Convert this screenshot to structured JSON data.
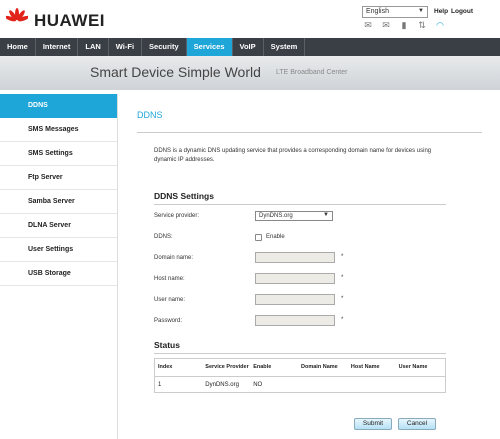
{
  "header": {
    "brand": "HUAWEI",
    "language": "English",
    "help_label": "Help",
    "logout_label": "Logout"
  },
  "nav": {
    "items": [
      "Home",
      "Internet",
      "LAN",
      "Wi-Fi",
      "Security",
      "Services",
      "VoIP",
      "System"
    ],
    "active": "Services"
  },
  "banner": {
    "slogan": "Smart Device  Simple World",
    "subtitle": "LTE Broadband Center"
  },
  "sidebar": {
    "items": [
      "DDNS",
      "SMS Messages",
      "SMS Settings",
      "Ftp Server",
      "Samba Server",
      "DLNA Server",
      "User Settings",
      "USB Storage"
    ],
    "active": "DDNS"
  },
  "main": {
    "title": "DDNS",
    "description": "DDNS is a dynamic DNS updating service that provides a corresponding domain name for devices using dynamic IP addresses.",
    "settings_title": "DDNS Settings",
    "fields": {
      "provider_label": "Service provider:",
      "provider_value": "DynDNS.org",
      "ddns_label": "DDNS:",
      "enable_label": "Enable",
      "enabled": false,
      "domain_label": "Domain name:",
      "host_label": "Host name:",
      "user_label": "User name:",
      "password_label": "Password:",
      "required_mark": "*"
    },
    "status_title": "Status",
    "status_table": {
      "headers": [
        "Index",
        "Service Provider",
        "Enable",
        "Domain Name",
        "Host Name",
        "User Name"
      ],
      "rows": [
        [
          "1",
          "DynDNS.org",
          "NO",
          "",
          "",
          ""
        ]
      ]
    },
    "submit_label": "Submit",
    "cancel_label": "Cancel"
  },
  "colors": {
    "accent": "#1ea6d8",
    "nav_bg": "#3a3f45",
    "logo_red": "#e2231a"
  },
  "icons": [
    "huawei-logo-icon",
    "sms-icon",
    "envelope-icon",
    "signal-icon",
    "network-icon",
    "wifi-icon"
  ]
}
